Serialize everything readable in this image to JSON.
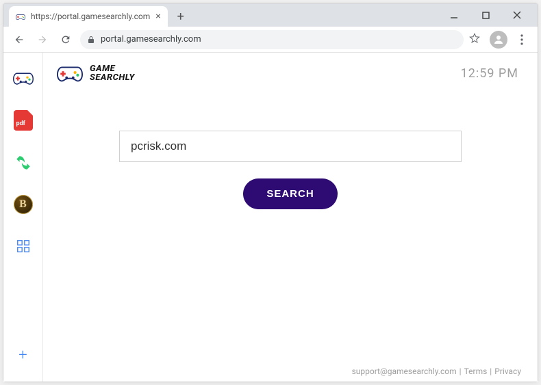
{
  "chrome": {
    "tab_title": "https://portal.gamesearchly.com",
    "url_display": "portal.gamesearchly.com"
  },
  "brand": {
    "line1": "GAME",
    "line2": "SEARCHLY"
  },
  "clock": "12:59 PM",
  "sidebar": {
    "pdf_label": "pdf",
    "coin_letter": "B"
  },
  "search": {
    "input_value": "pcrisk.com",
    "placeholder": "",
    "button_label": "SEARCH"
  },
  "footer": {
    "email": "support@gamesearchly.com",
    "terms": "Terms",
    "privacy": "Privacy",
    "sep": " | "
  },
  "colors": {
    "accent": "#2e0b73",
    "link_blue": "#4285f4"
  }
}
